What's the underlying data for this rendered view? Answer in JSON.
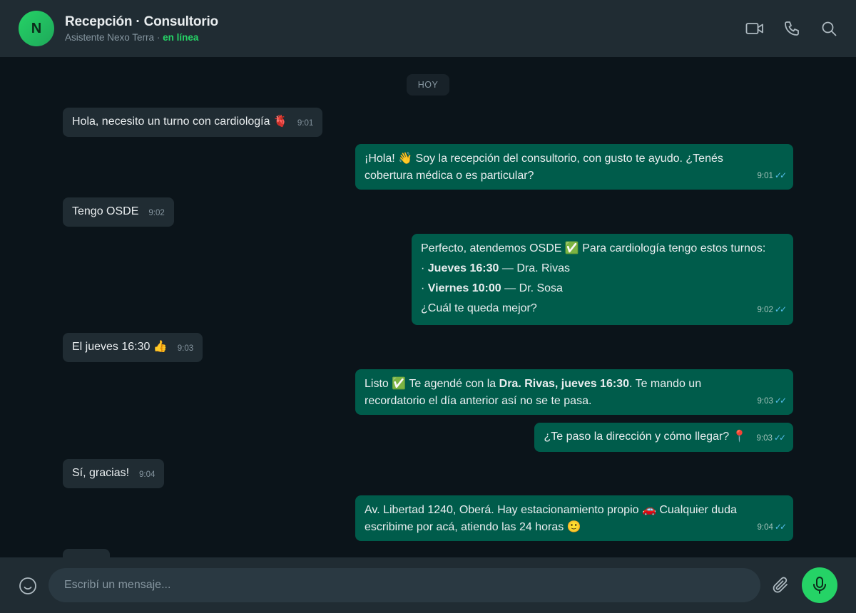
{
  "header": {
    "avatar_initial": "N",
    "title": "Recepción · Consultorio",
    "subtitle_name": "Asistente Nexo Terra",
    "subtitle_sep": " · ",
    "status": "en línea"
  },
  "chat": {
    "day_label": "HOY",
    "messages": [
      {
        "dir": "in",
        "text": "Hola, necesito un turno con cardiología 🫀",
        "time": "9:01"
      },
      {
        "dir": "out",
        "lines": [
          "¡Hola! 👋 Soy la recepción del consultorio, con gusto te ayudo. ¿Tenés",
          "cobertura médica o es particular?"
        ],
        "time": "9:01"
      },
      {
        "dir": "in",
        "text": "Tengo OSDE",
        "time": "9:02"
      },
      {
        "dir": "out",
        "intro": "Perfecto, atendemos OSDE ✅ Para cardiología tengo estos turnos:",
        "slots": [
          {
            "bullet": "· ",
            "when": "Jueves 16:30",
            "who": " — Dra. Rivas"
          },
          {
            "bullet": "· ",
            "when": "Viernes 10:00",
            "who": " — Dr. Sosa"
          }
        ],
        "outro": "¿Cuál te queda mejor?",
        "time": "9:02"
      },
      {
        "dir": "in",
        "text": "El jueves 16:30 👍",
        "time": "9:03"
      },
      {
        "dir": "out",
        "pre": "Listo ✅ Te agendé con la ",
        "bold": "Dra. Rivas, jueves 16:30",
        "post": ". Te mando un",
        "line2": "recordatorio el día anterior así no se te pasa.",
        "time": "9:03"
      },
      {
        "dir": "out",
        "text": "¿Te paso la dirección y cómo llegar? 📍",
        "time": "9:03"
      },
      {
        "dir": "in",
        "text": "Sí, gracias!",
        "time": "9:04"
      },
      {
        "dir": "out",
        "lines": [
          "Av. Libertad 1240, Oberá. Hay estacionamiento propio 🚗 Cualquier duda",
          "escribime por acá, atiendo las 24 horas 🙂"
        ],
        "time": "9:04"
      }
    ],
    "read_ticks": "✓✓"
  },
  "composer": {
    "placeholder": "Escribí un mensaje..."
  },
  "colors": {
    "incoming": "#202c33",
    "outgoing": "#005c4b",
    "accent": "#25d366",
    "ticks": "#53bdeb"
  },
  "icons": [
    "video-camera-icon",
    "phone-icon",
    "search-icon",
    "emoji-icon",
    "paperclip-icon",
    "microphone-icon"
  ]
}
